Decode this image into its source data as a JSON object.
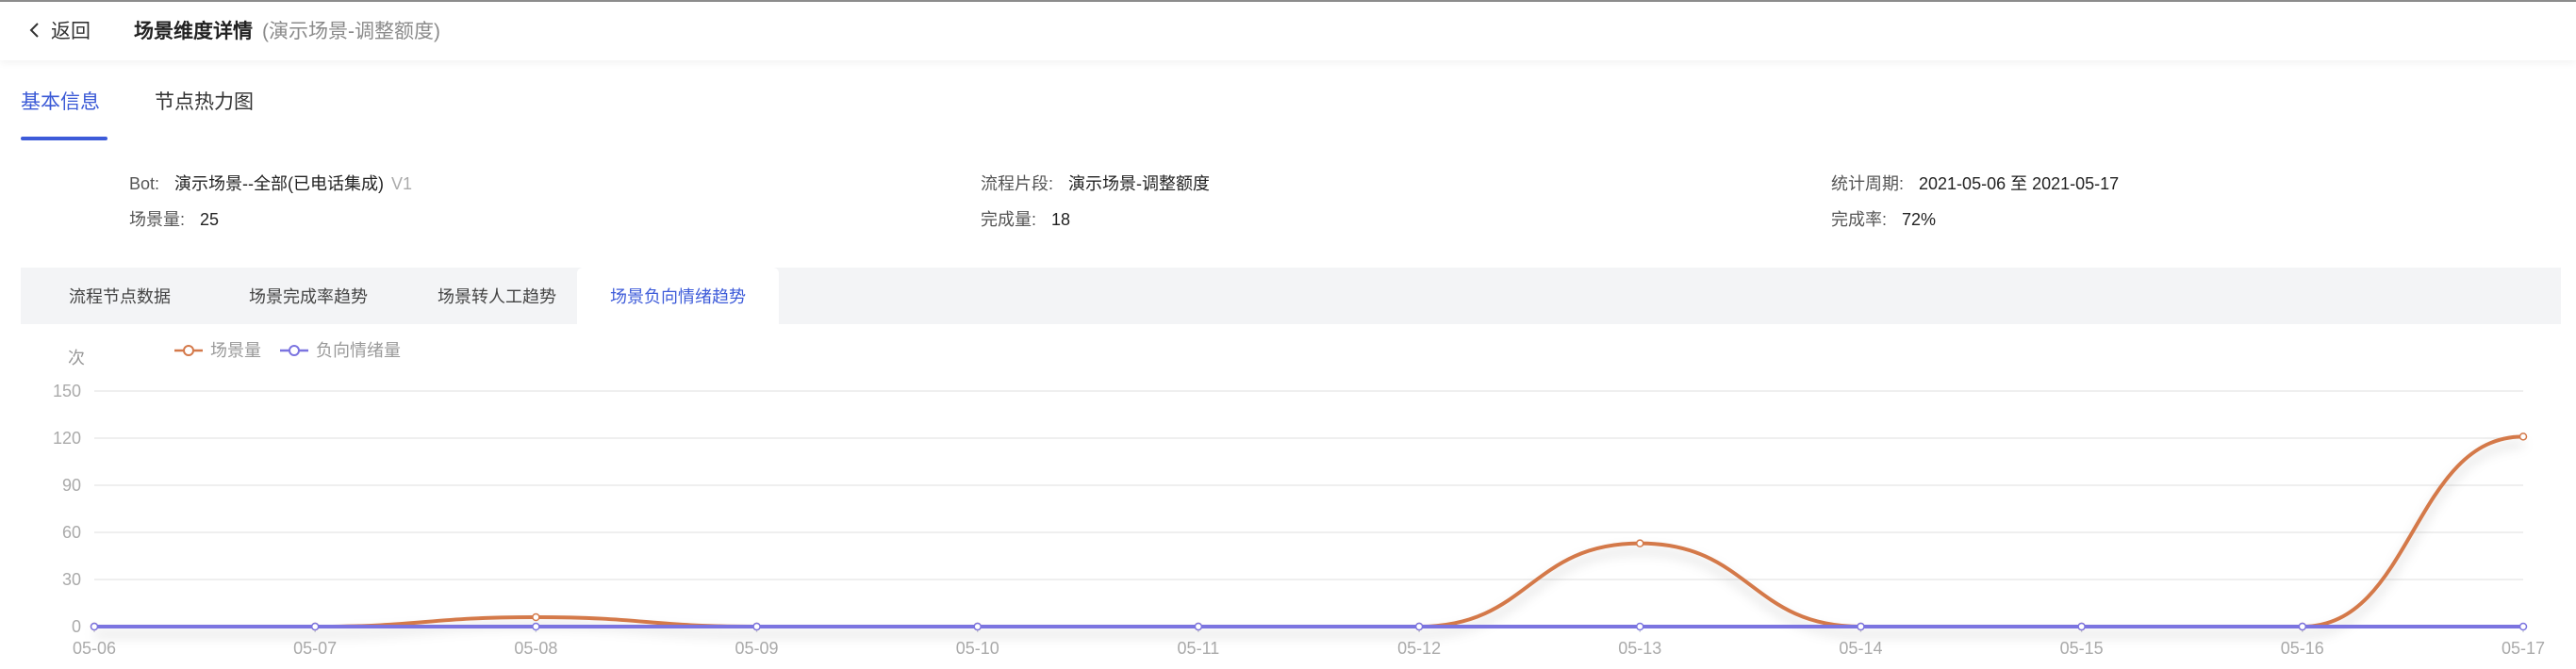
{
  "header": {
    "back_label": "返回",
    "title": "场景维度详情",
    "subtitle": "(演示场景-调整额度)"
  },
  "tabs": [
    {
      "label": "基本信息",
      "active": true
    },
    {
      "label": "节点热力图",
      "active": false
    }
  ],
  "info": {
    "bot_label": "Bot:",
    "bot_value": "演示场景--全部(已电话集成)",
    "bot_version": "V1",
    "scene_count_label": "场景量:",
    "scene_count_value": "25",
    "segment_label": "流程片段:",
    "segment_value": "演示场景-调整额度",
    "complete_count_label": "完成量:",
    "complete_count_value": "18",
    "period_label": "统计周期:",
    "period_value": "2021-05-06 至 2021-05-17",
    "complete_rate_label": "完成率:",
    "complete_rate_value": "72%"
  },
  "subtabs": [
    {
      "label": "流程节点数据",
      "active": false
    },
    {
      "label": "场景完成率趋势",
      "active": false
    },
    {
      "label": "场景转人工趋势",
      "active": false
    },
    {
      "label": "场景负向情绪趋势",
      "active": true
    }
  ],
  "colors": {
    "accent": "#3d5bd9",
    "series_scene": "#d4794a",
    "series_negative": "#7b74e0"
  },
  "chart_data": {
    "type": "line",
    "ylabel": "次",
    "ylim": [
      0,
      150
    ],
    "yticks": [
      0,
      30,
      60,
      90,
      120,
      150
    ],
    "grid": true,
    "legend": "top-left",
    "categories": [
      "05-06",
      "05-07",
      "05-08",
      "05-09",
      "05-10",
      "05-11",
      "05-12",
      "05-13",
      "05-14",
      "05-15",
      "05-16",
      "05-17"
    ],
    "series": [
      {
        "name": "场景量",
        "color": "#d4794a",
        "values": [
          0,
          0,
          6,
          0,
          0,
          0,
          0,
          53,
          0,
          0,
          0,
          121
        ]
      },
      {
        "name": "负向情绪量",
        "color": "#7b74e0",
        "values": [
          0,
          0,
          0,
          0,
          0,
          0,
          0,
          0,
          0,
          0,
          0,
          0
        ]
      }
    ]
  }
}
